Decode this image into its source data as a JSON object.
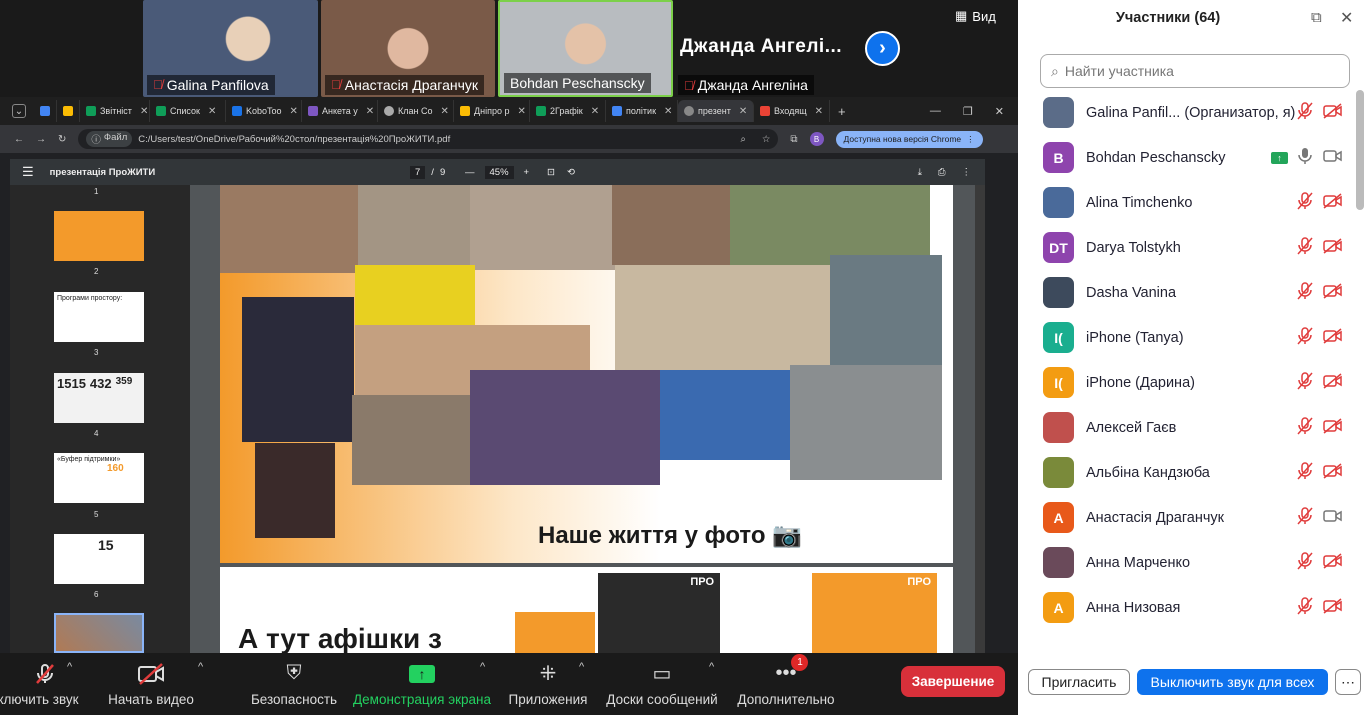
{
  "video_strip": {
    "tiles": [
      {
        "name": "Galina Panfilova",
        "bg": "#5b6c88"
      },
      {
        "name": "Анастасія Драганчук",
        "bg": "#8a6a55"
      },
      {
        "name": "Bohdan Peschanscky",
        "bg": "#9aa0a8"
      }
    ],
    "speaker_name_large": "Джанда  Ангелі...",
    "speaker_name_small": "Джанда Ангеліна",
    "view_label": "Вид"
  },
  "browser": {
    "tabs": [
      "Звітніст",
      "Список",
      "KoboToo",
      "Анкета у",
      "Клан Со",
      "Дніпро р",
      "2Графік",
      "політик",
      "презент",
      "Входящ"
    ],
    "file_label": "Файл",
    "url": "C:/Users/test/OneDrive/Рабочий%20стол/презентація%20ПроЖИТИ.pdf",
    "update_label": "Доступна нова версія Chrome",
    "profile_letter": "B"
  },
  "pdf": {
    "title": "презентація ПроЖИТИ",
    "page_current": "7",
    "page_total": "9",
    "zoom": "45%",
    "thumb_numbers": [
      "1",
      "2",
      "3",
      "4",
      "5",
      "6"
    ],
    "thumb_texts": {
      "t3": "Програми простору:",
      "t4a": "1515",
      "t4b": "432",
      "t4c": "359",
      "t5": "«Буфер підтримки»",
      "t5b": "160",
      "t6": "15"
    },
    "slide_caption": "Наше життя у фото 📷",
    "slide2_text": "А тут афішки з",
    "slide2_logo": "ПРО"
  },
  "toolbar": {
    "mute": "ключить звук",
    "video": "Начать видео",
    "security": "Безопасность",
    "share": "Демонстрация экрана",
    "apps": "Приложения",
    "boards": "Доски сообщений",
    "more": "Дополнительно",
    "more_badge": "1",
    "end": "Завершение"
  },
  "panel": {
    "title": "Участники (64)",
    "search_placeholder": "Найти участника",
    "participants": [
      {
        "name": "Galina Panfil...   (Организатор, я)",
        "initials": "",
        "color": "#5b6c88",
        "mic": "off",
        "cam": "off"
      },
      {
        "name": "Bohdan Peschanscky",
        "initials": "B",
        "color": "#8e44ad",
        "mic": "on",
        "cam": "on",
        "sharing": true
      },
      {
        "name": "Alina Timchenko",
        "initials": "",
        "color": "#4a6a9a",
        "mic": "off",
        "cam": "off"
      },
      {
        "name": "Darya Tolstykh",
        "initials": "DT",
        "color": "#8e44ad",
        "mic": "off",
        "cam": "off"
      },
      {
        "name": "Dasha Vanina",
        "initials": "",
        "color": "#3d4a5c",
        "mic": "off",
        "cam": "off"
      },
      {
        "name": "iPhone (Tanya)",
        "initials": "I(",
        "color": "#1aae8f",
        "mic": "off",
        "cam": "off"
      },
      {
        "name": "iPhone (Дарина)",
        "initials": "I(",
        "color": "#f39c12",
        "mic": "off",
        "cam": "off"
      },
      {
        "name": "Алексей Гаєв",
        "initials": "",
        "color": "#c0504d",
        "mic": "off",
        "cam": "off"
      },
      {
        "name": "Альбіна Кандзюба",
        "initials": "",
        "color": "#7a8a3a",
        "mic": "off",
        "cam": "off"
      },
      {
        "name": "Анастасія Драганчук",
        "initials": "A",
        "color": "#e8591a",
        "mic": "off",
        "cam": "on"
      },
      {
        "name": "Анна Марченко",
        "initials": "",
        "color": "#6a4a5a",
        "mic": "off",
        "cam": "off"
      },
      {
        "name": "Анна Низовая",
        "initials": "A",
        "color": "#f39c12",
        "mic": "off",
        "cam": "off"
      }
    ],
    "invite": "Пригласить",
    "mute_all": "Выключить звук для всех",
    "more": "⋯"
  }
}
